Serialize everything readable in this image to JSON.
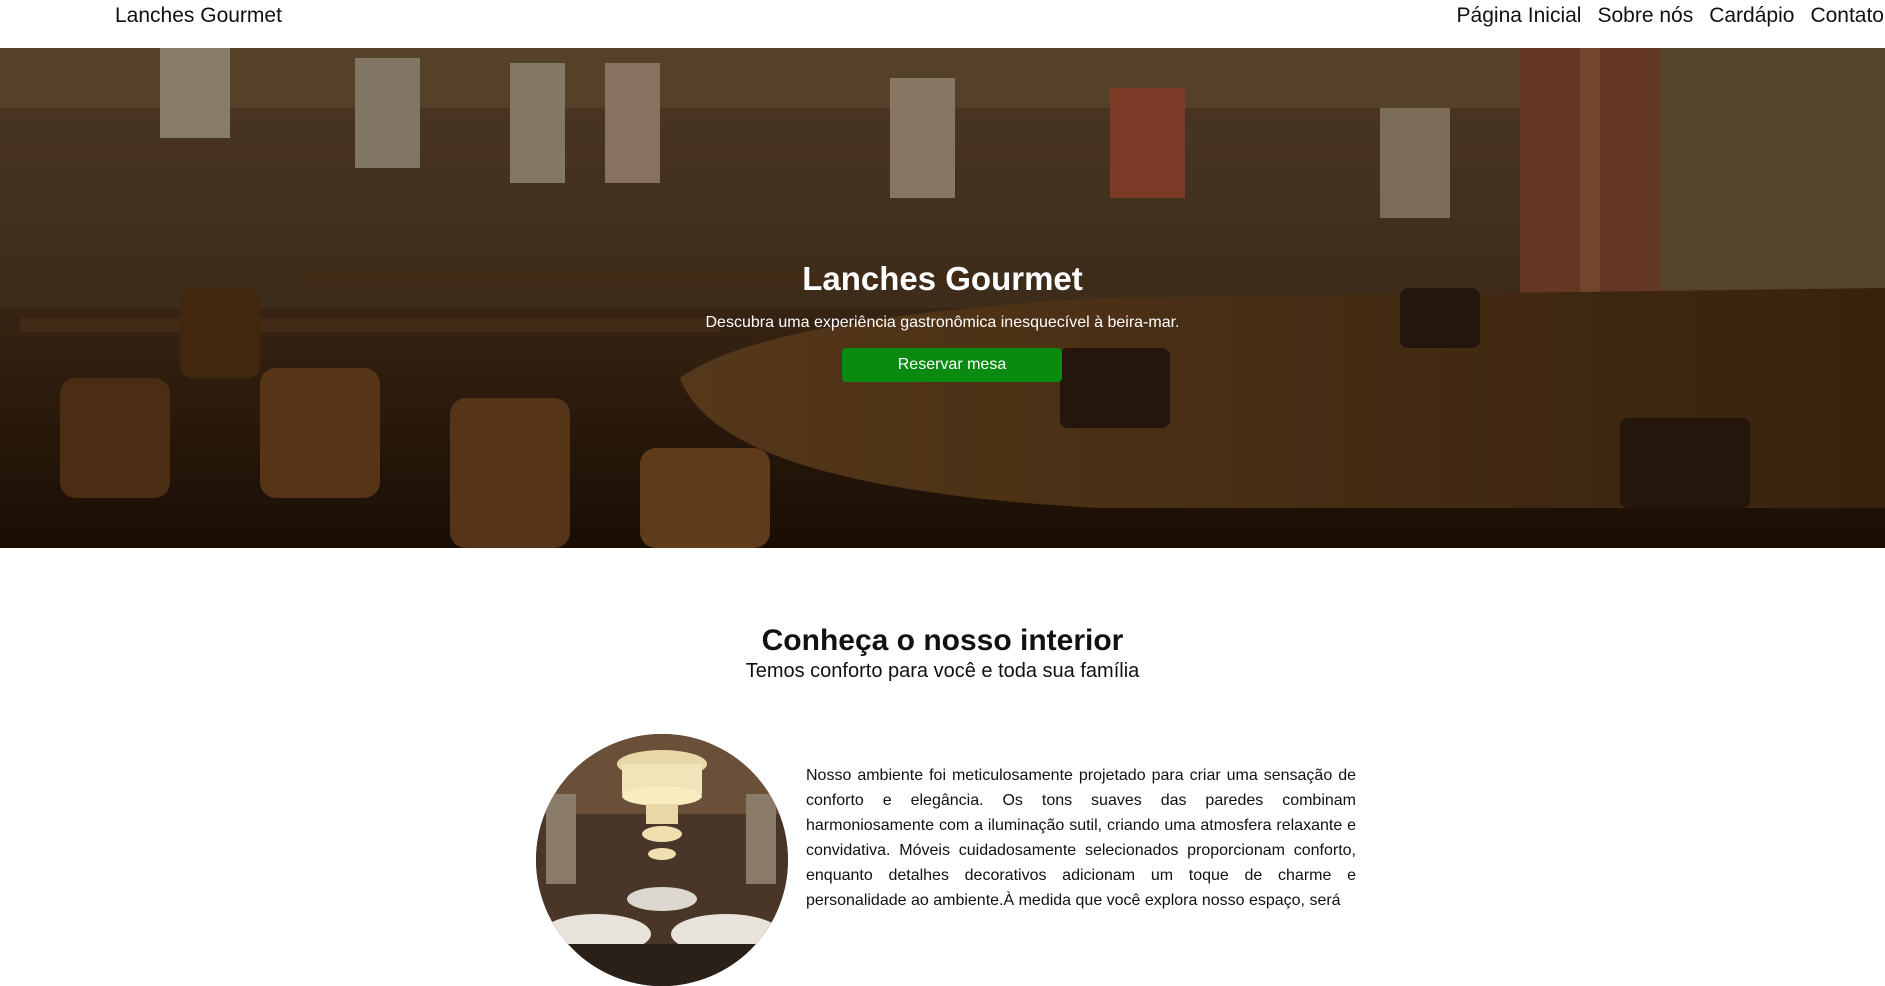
{
  "navbar": {
    "brand": "Lanches Gourmet",
    "links": [
      "Página Inicial",
      "Sobre nós",
      "Cardápio",
      "Contato"
    ]
  },
  "hero": {
    "title": "Lanches Gourmet",
    "subtitle": "Descubra uma experiência gastronômica inesquecível à beira-mar.",
    "button_label": "Reservar mesa",
    "button_color": "#0b8a12",
    "background_image": "restaurant-interior-photo"
  },
  "interior": {
    "title": "Conheça o nosso interior",
    "subtitle": "Temos conforto para você e toda sua família",
    "image": "dining-room-chandelier-photo",
    "text": "Nosso ambiente foi meticulosamente projetado para criar uma sensação de conforto e elegância. Os tons suaves das paredes combinam harmoniosamente com a iluminação sutil, criando uma atmosfera relaxante e convidativa. Móveis cuidadosamente selecionados proporcionam conforto, enquanto detalhes decorativos adicionam um toque de charme e personalidade ao ambiente.À medida que você explora nosso espaço, será"
  }
}
